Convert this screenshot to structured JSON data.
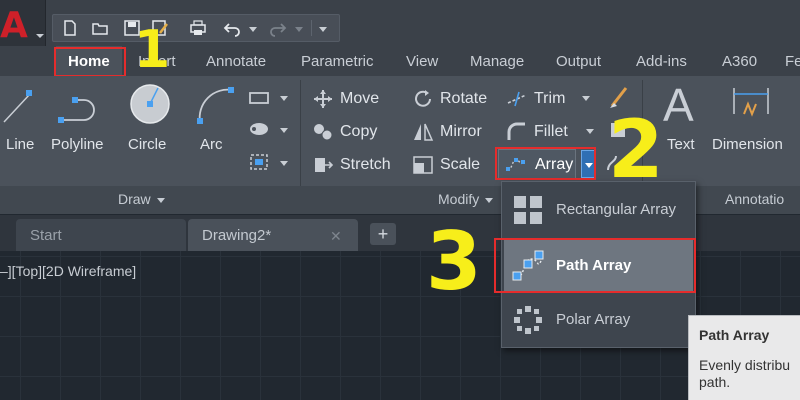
{
  "quick_access": {
    "app_letter": "A",
    "icons": [
      "new-icon",
      "open-icon",
      "save-icon",
      "save-as-icon",
      "plot-icon",
      "undo-icon",
      "redo-icon",
      "customize-icon"
    ]
  },
  "ribbon_tabs": [
    "Home",
    "Insert",
    "Annotate",
    "Parametric",
    "View",
    "Manage",
    "Output",
    "Add-ins",
    "A360",
    "Fe"
  ],
  "active_tab": "Home",
  "draw_panel": {
    "title": "Draw",
    "line": "Line",
    "polyline": "Polyline",
    "circle": "Circle",
    "arc": "Arc"
  },
  "modify_panel": {
    "title": "Modify",
    "move": "Move",
    "rotate": "Rotate",
    "trim": "Trim",
    "copy": "Copy",
    "mirror": "Mirror",
    "fillet": "Fillet",
    "stretch": "Stretch",
    "scale": "Scale",
    "array": "Array"
  },
  "annotation_panel": {
    "title": "Annotatio",
    "text": "Text",
    "dimension": "Dimension"
  },
  "file_tabs": {
    "start": "Start",
    "drawing": "Drawing2*",
    "add": "+"
  },
  "viewport_label": "–][Top][2D Wireframe]",
  "array_menu": {
    "items": [
      "Rectangular Array",
      "Path Array",
      "Polar Array"
    ],
    "hovered": "Path Array"
  },
  "tooltip": {
    "title": "Path Array",
    "description": "Evenly distribu path."
  },
  "steps": [
    "1",
    "2",
    "3"
  ],
  "colors": {
    "highlight": "#e52c2c",
    "step_number": "#f7ee1a",
    "accent": "#2f6fb4"
  }
}
